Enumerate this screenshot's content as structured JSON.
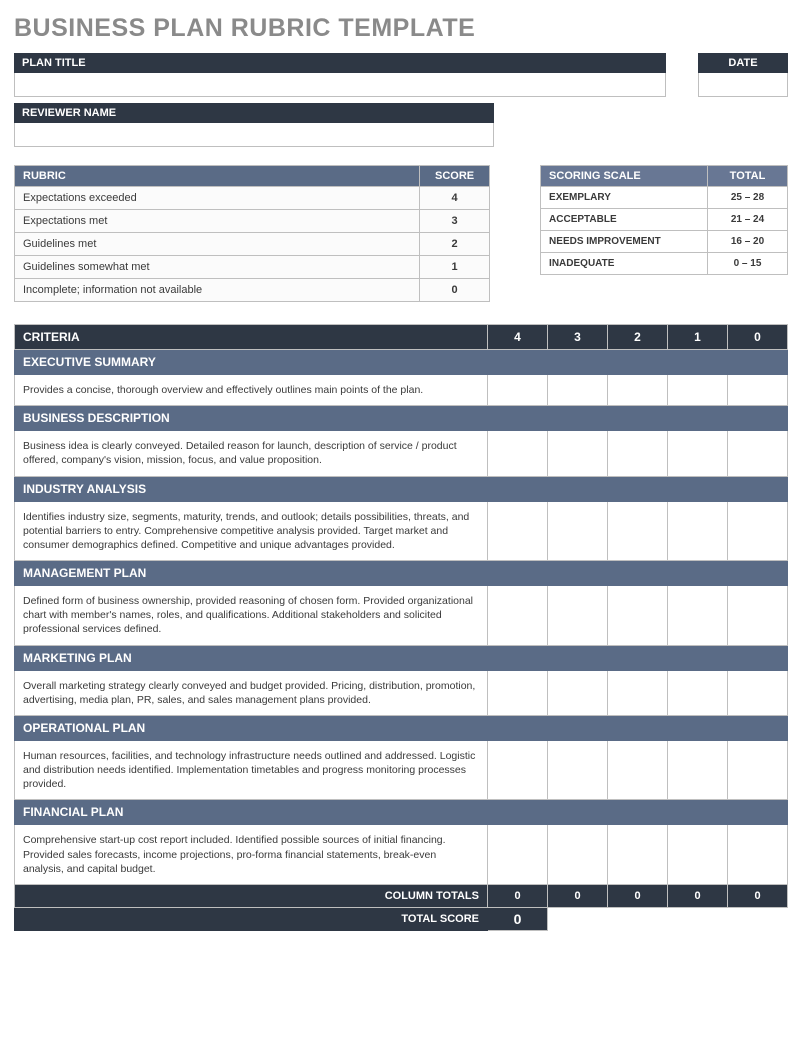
{
  "page_title": "BUSINESS PLAN RUBRIC TEMPLATE",
  "labels": {
    "plan_title": "PLAN TITLE",
    "date": "DATE",
    "reviewer": "REVIEWER NAME",
    "rubric": "RUBRIC",
    "score": "SCORE",
    "scoring_scale": "SCORING SCALE",
    "total": "TOTAL",
    "criteria": "CRITERIA",
    "column_totals": "COLUMN TOTALS",
    "total_score": "TOTAL SCORE"
  },
  "rubric": [
    {
      "label": "Expectations exceeded",
      "score": "4"
    },
    {
      "label": "Expectations met",
      "score": "3"
    },
    {
      "label": "Guidelines met",
      "score": "2"
    },
    {
      "label": "Guidelines somewhat met",
      "score": "1"
    },
    {
      "label": "Incomplete; information not available",
      "score": "0"
    }
  ],
  "scoring_scale": [
    {
      "label": "EXEMPLARY",
      "range": "25 – 28"
    },
    {
      "label": "ACCEPTABLE",
      "range": "21 – 24"
    },
    {
      "label": "NEEDS IMPROVEMENT",
      "range": "16 – 20"
    },
    {
      "label": "INADEQUATE",
      "range": "0 – 15"
    }
  ],
  "criteria_columns": [
    "4",
    "3",
    "2",
    "1",
    "0"
  ],
  "criteria": [
    {
      "title": "EXECUTIVE SUMMARY",
      "desc": "Provides a concise, thorough overview and effectively outlines main points of the plan."
    },
    {
      "title": "BUSINESS DESCRIPTION",
      "desc": "Business idea is clearly conveyed. Detailed reason for launch, description of service / product offered, company's vision, mission, focus, and value proposition."
    },
    {
      "title": "INDUSTRY ANALYSIS",
      "desc": "Identifies industry size, segments, maturity, trends, and outlook; details possibilities, threats, and potential barriers to entry. Comprehensive competitive analysis provided. Target market and consumer demographics defined. Competitive and unique advantages provided."
    },
    {
      "title": "MANAGEMENT PLAN",
      "desc": "Defined form of business ownership, provided reasoning of chosen form. Provided organizational chart with member's names, roles, and qualifications.  Additional stakeholders and solicited professional services defined."
    },
    {
      "title": "MARKETING PLAN",
      "desc": "Overall marketing strategy clearly conveyed and budget provided. Pricing, distribution, promotion, advertising, media plan, PR, sales, and sales management plans provided."
    },
    {
      "title": "OPERATIONAL PLAN",
      "desc": "Human resources, facilities, and technology infrastructure needs outlined and addressed. Logistic and distribution needs identified.  Implementation timetables and progress monitoring processes provided."
    },
    {
      "title": "FINANCIAL PLAN",
      "desc": "Comprehensive start-up cost report included. Identified possible sources of initial financing.  Provided sales forecasts, income projections, pro-forma financial statements, break-even analysis, and capital budget."
    }
  ],
  "column_totals": [
    "0",
    "0",
    "0",
    "0",
    "0"
  ],
  "total_score": "0",
  "inputs": {
    "plan_title": "",
    "date": "",
    "reviewer": ""
  }
}
